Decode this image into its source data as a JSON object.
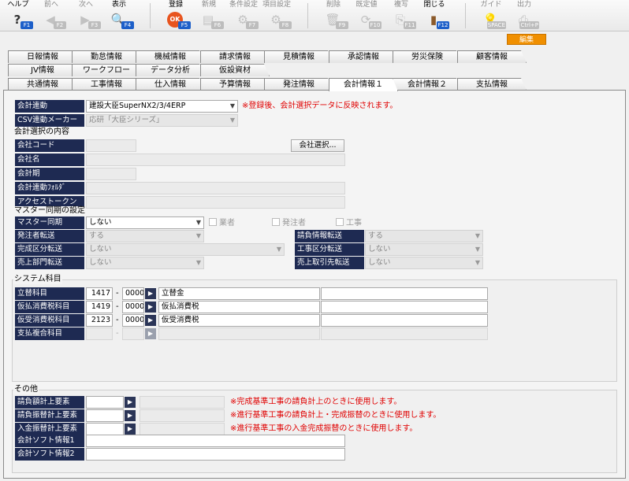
{
  "toolbar": {
    "items": [
      {
        "label": "ヘルプ",
        "key": "F1",
        "icon": "help-icon",
        "glyph": "?",
        "enabled": true
      },
      {
        "label": "前へ",
        "key": "F2",
        "icon": "arrow-left-icon",
        "glyph": "◀",
        "enabled": false
      },
      {
        "label": "次へ",
        "key": "F3",
        "icon": "arrow-right-icon",
        "glyph": "▶",
        "enabled": false
      },
      {
        "label": "表示",
        "key": "F4",
        "icon": "magnifier-icon",
        "glyph": "🔍",
        "enabled": true
      },
      {
        "label": "登録",
        "key": "F5",
        "icon": "ok-icon",
        "glyph": "OK",
        "enabled": true
      },
      {
        "label": "新規",
        "key": "F6",
        "icon": "new-document-icon",
        "glyph": "▤",
        "enabled": false
      },
      {
        "label": "条件設定",
        "key": "F7",
        "icon": "condition-icon",
        "glyph": "⚙",
        "enabled": false
      },
      {
        "label": "項目設定",
        "key": "F8",
        "icon": "item-settings-icon",
        "glyph": "⚙",
        "enabled": false
      },
      {
        "label": "削除",
        "key": "F9",
        "icon": "trash-icon",
        "glyph": "🗑",
        "enabled": false
      },
      {
        "label": "既定値",
        "key": "F10",
        "icon": "refresh-icon",
        "glyph": "⟳",
        "enabled": false
      },
      {
        "label": "複写",
        "key": "F11",
        "icon": "copy-icon",
        "glyph": "⎘",
        "enabled": false
      },
      {
        "label": "閉じる",
        "key": "F12",
        "icon": "close-door-icon",
        "glyph": "▮",
        "enabled": true
      },
      {
        "label": "ガイド",
        "key": "SPACE",
        "icon": "bulb-icon",
        "glyph": "💡",
        "enabled": false
      },
      {
        "label": "出力",
        "key": "Ctrl+P",
        "icon": "print-icon",
        "glyph": "⎙",
        "enabled": false
      }
    ],
    "edit_label": "編集",
    "edit_color": "#f08f00"
  },
  "tabs_row1": [
    "日報情報",
    "勤怠情報",
    "機械情報",
    "請求情報",
    "見積情報",
    "承認情報",
    "労災保険",
    "顧客情報"
  ],
  "tabs_row2": [
    "JV情報",
    "ワークフロー",
    "データ分析",
    "仮設資材"
  ],
  "tabs_row3": [
    "共通情報",
    "工事情報",
    "仕入情報",
    "予算情報",
    "発注情報",
    "会計情報１",
    "会計情報２",
    "支払情報"
  ],
  "active_tab": "会計情報１",
  "form": {
    "kaikei_renkei_label": "会計連動",
    "kaikei_renkei_value": "建設大臣SuperNX2/3/4ERP",
    "kaikei_note": "※登録後、会計選択データに反映されます。",
    "csv_label": "CSV連動メーカー",
    "csv_value": "応研「大臣シリーズ」",
    "selection_title": "会計選択の内容",
    "company_code_label": "会社コード",
    "company_select_button": "会社選択...",
    "company_name_label": "会社名",
    "fiscal_period_label": "会計期",
    "folder_label": "会計連動ﾌｫﾙﾀﾞ",
    "token_label": "アクセストークン",
    "master_title": "マスター同期の設定",
    "master_sync_label": "マスター同期",
    "master_sync_value": "しない",
    "cb_vendor": "業者",
    "cb_orderer": "発注者",
    "cb_project": "工事",
    "orderer_transfer_label": "発注者転送",
    "orderer_transfer_value": "する",
    "completion_label": "完成区分転送",
    "completion_value": "しない",
    "sales_dept_label": "売上部門転送",
    "sales_dept_value": "しない",
    "contract_label": "請負情報転送",
    "contract_value": "する",
    "project_class_label": "工事区分転送",
    "project_class_value": "しない",
    "sales_client_label": "売上取引先転送",
    "sales_client_value": "しない",
    "system_title": "システム科目",
    "accounts": [
      {
        "label": "立替科目",
        "code": "1417",
        "sub": "0000",
        "name": "立替金",
        "enabled": true
      },
      {
        "label": "仮払消費税科目",
        "code": "1419",
        "sub": "0000",
        "name": "仮払消費税",
        "enabled": true
      },
      {
        "label": "仮受消費税科目",
        "code": "2123",
        "sub": "0000",
        "name": "仮受消費税",
        "enabled": true
      },
      {
        "label": "支払複合科目",
        "code": "",
        "sub": "",
        "name": "",
        "enabled": false
      }
    ],
    "dash": "-",
    "other_title": "その他",
    "requirements": [
      {
        "label": "請負額計上要素",
        "note": "※完成基準工事の請負計上のときに使用します。"
      },
      {
        "label": "請負振替計上要素",
        "note": "※進行基準工事の請負計上・完成振替のときに使用します。"
      },
      {
        "label": "入金振替計上要素",
        "note": "※進行基準工事の入金完成振替のときに使用します。"
      }
    ],
    "soft_info1_label": "会計ソフト情報1",
    "soft_info2_label": "会計ソフト情報2"
  }
}
